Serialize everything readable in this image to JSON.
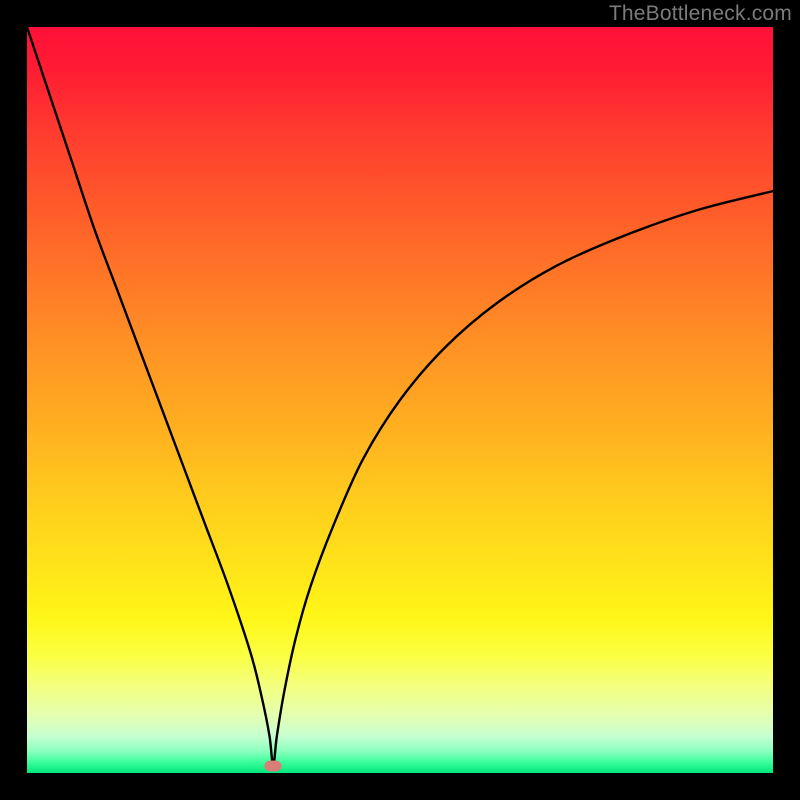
{
  "watermark": "TheBottleneck.com",
  "chart_data": {
    "type": "line",
    "title": "",
    "xlabel": "",
    "ylabel": "",
    "xlim": [
      0,
      100
    ],
    "ylim": [
      0,
      100
    ],
    "grid": false,
    "legend": false,
    "marker": {
      "x": 33,
      "y": 1
    },
    "series": [
      {
        "name": "bottleneck-curve",
        "x": [
          0,
          3,
          6,
          9,
          12,
          15,
          18,
          21,
          24,
          27,
          30,
          31.5,
          32.5,
          33,
          33.5,
          34.5,
          36,
          38,
          41,
          45,
          50,
          56,
          63,
          71,
          80,
          90,
          100
        ],
        "y": [
          100,
          91,
          82,
          73,
          65,
          57,
          49,
          41,
          33,
          25,
          16,
          10,
          5,
          1,
          5,
          11,
          18,
          25,
          33,
          42,
          50,
          57,
          63,
          68,
          72,
          75.5,
          78
        ]
      }
    ],
    "background_gradient": {
      "top": "#ff1038",
      "bottom": "#00e77a"
    },
    "colors": {
      "curve": "#000000",
      "marker": "#d87d78"
    }
  }
}
